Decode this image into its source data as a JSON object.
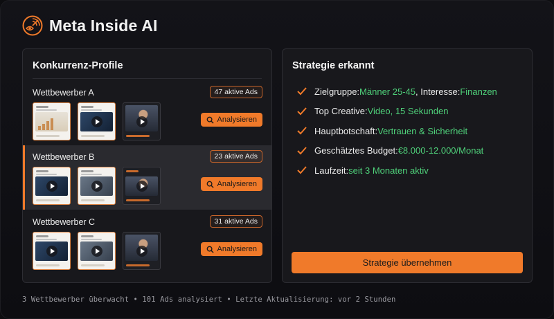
{
  "app": {
    "title": "Meta Inside AI",
    "logo_icon": "radar-eye-icon"
  },
  "competitors_panel": {
    "title": "Konkurrenz-Profile",
    "analyze_label": "Analysieren",
    "items": [
      {
        "name": "Wettbewerber A",
        "ads_badge": "47 aktive Ads",
        "active": false,
        "thumbnails": [
          "chart-ad",
          "video-ad",
          "person-video-ad"
        ]
      },
      {
        "name": "Wettbewerber B",
        "ads_badge": "23 aktive Ads",
        "active": true,
        "thumbnails": [
          "video-ad",
          "video-ad",
          "person-video-ad"
        ]
      },
      {
        "name": "Wettbewerber C",
        "ads_badge": "31 aktive Ads",
        "active": false,
        "thumbnails": [
          "video-ad",
          "video-ad",
          "person-video-ad"
        ]
      }
    ]
  },
  "strategy_panel": {
    "title": "Strategie erkannt",
    "items": [
      {
        "label": "Zielgruppe: ",
        "value": "Männer 25-45",
        "label2": ", Interesse: ",
        "value2": "Finanzen"
      },
      {
        "label": "Top Creative: ",
        "value": "Video, 15 Sekunden"
      },
      {
        "label": "Hauptbotschaft: ",
        "value": "Vertrauen & Sicherheit"
      },
      {
        "label": "Geschätztes Budget: ",
        "value": "€8.000-12.000/Monat"
      },
      {
        "label": "Laufzeit: ",
        "value": "seit 3 Monaten aktiv"
      }
    ],
    "adopt_button": "Strategie übernehmen"
  },
  "footer": {
    "status": "3 Wettbewerber überwacht • 101 Ads analysiert • Letzte Aktualisierung: vor 2 Stunden"
  },
  "colors": {
    "accent": "#f07a2a",
    "highlight": "#4fd17a",
    "background": "#0d0d10",
    "panel": "#18181c"
  }
}
